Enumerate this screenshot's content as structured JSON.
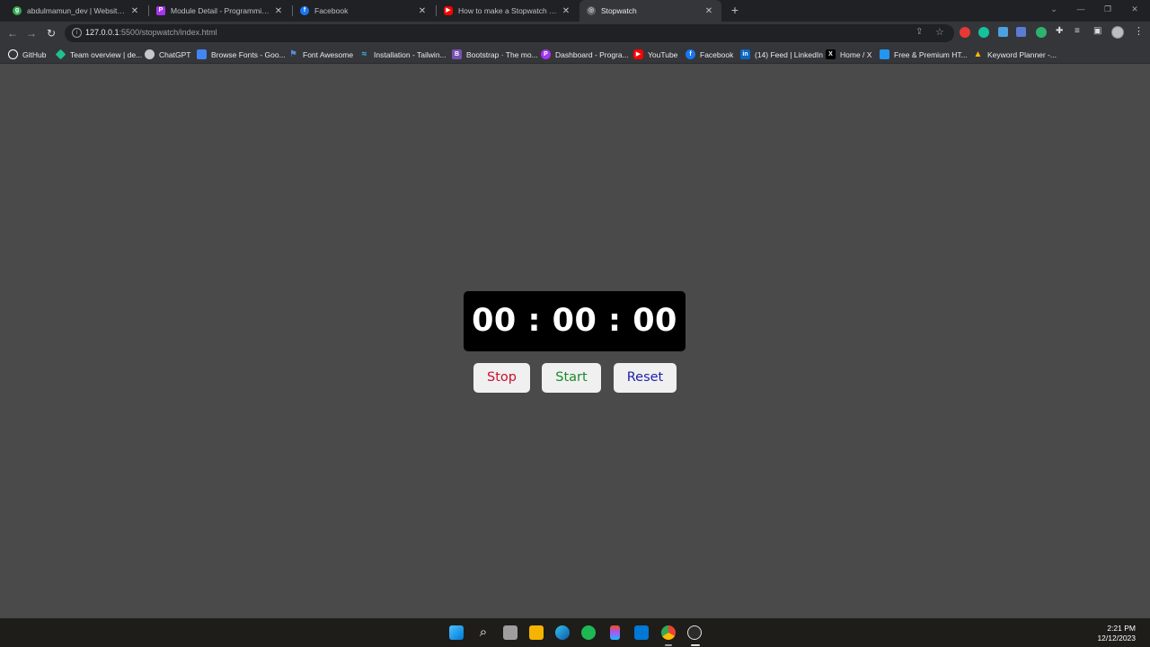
{
  "browser": {
    "tabs": [
      {
        "title": "abdulmamun_dev | Website De",
        "icon": "green-circle-icon",
        "color": "#34a853"
      },
      {
        "title": "Module Detail - Programming H",
        "icon": "programming-hero-icon",
        "color": "#a435f0"
      },
      {
        "title": "Facebook",
        "icon": "facebook-icon",
        "color": "#1877f2"
      },
      {
        "title": "How to make a Stopwatch using",
        "icon": "youtube-icon",
        "color": "#ff0000"
      },
      {
        "title": "Stopwatch",
        "icon": "globe-icon",
        "color": "#9aa0a6",
        "active": true
      }
    ],
    "new_tab": "+",
    "url_host": "127.0.0.1",
    "url_path": ":5500/stopwatch/index.html",
    "bookmarks": [
      {
        "label": "GitHub",
        "icon": "github-icon",
        "color": "#ffffff"
      },
      {
        "label": "Team overview | de...",
        "icon": "diamond-icon",
        "color": "#1ec28b"
      },
      {
        "label": "ChatGPT",
        "icon": "chatgpt-icon",
        "color": "#c8c8c8"
      },
      {
        "label": "Browse Fonts - Goo...",
        "icon": "google-fonts-icon",
        "color": "#4285f4"
      },
      {
        "label": "Font Awesome",
        "icon": "flag-icon",
        "color": "#538dd7"
      },
      {
        "label": "Installation - Tailwin...",
        "icon": "tailwind-icon",
        "color": "#38bdf8"
      },
      {
        "label": "Bootstrap · The mo...",
        "icon": "bootstrap-icon",
        "color": "#7952b3"
      },
      {
        "label": "Dashboard - Progra...",
        "icon": "programming-hero-icon",
        "color": "#a435f0"
      },
      {
        "label": "YouTube",
        "icon": "youtube-icon",
        "color": "#ff0000"
      },
      {
        "label": "Facebook",
        "icon": "facebook-icon",
        "color": "#1877f2"
      },
      {
        "label": "(14) Feed | LinkedIn",
        "icon": "linkedin-icon",
        "color": "#0a66c2"
      },
      {
        "label": "Home / X",
        "icon": "x-icon",
        "color": "#ffffff"
      },
      {
        "label": "Free & Premium HT...",
        "icon": "html-template-icon",
        "color": "#2196f3"
      },
      {
        "label": "Keyword Planner -...",
        "icon": "google-ads-icon",
        "color": "#fbbc04"
      }
    ]
  },
  "stopwatch": {
    "display": "00 : 00 : 00",
    "stop_label": "Stop",
    "start_label": "Start",
    "reset_label": "Reset",
    "colors": {
      "stop": "#c8102e",
      "start": "#1a8a2a",
      "reset": "#1f1fb0",
      "display_bg": "#000000",
      "page_bg": "#4a4a4a"
    }
  },
  "taskbar": {
    "time": "2:21 PM",
    "date": "12/12/2023",
    "apps": [
      "windows-start-icon",
      "search-icon",
      "task-view-icon",
      "file-explorer-icon",
      "edge-icon",
      "spotify-icon",
      "figma-icon",
      "vscode-icon",
      "chrome-icon",
      "obs-icon"
    ]
  }
}
